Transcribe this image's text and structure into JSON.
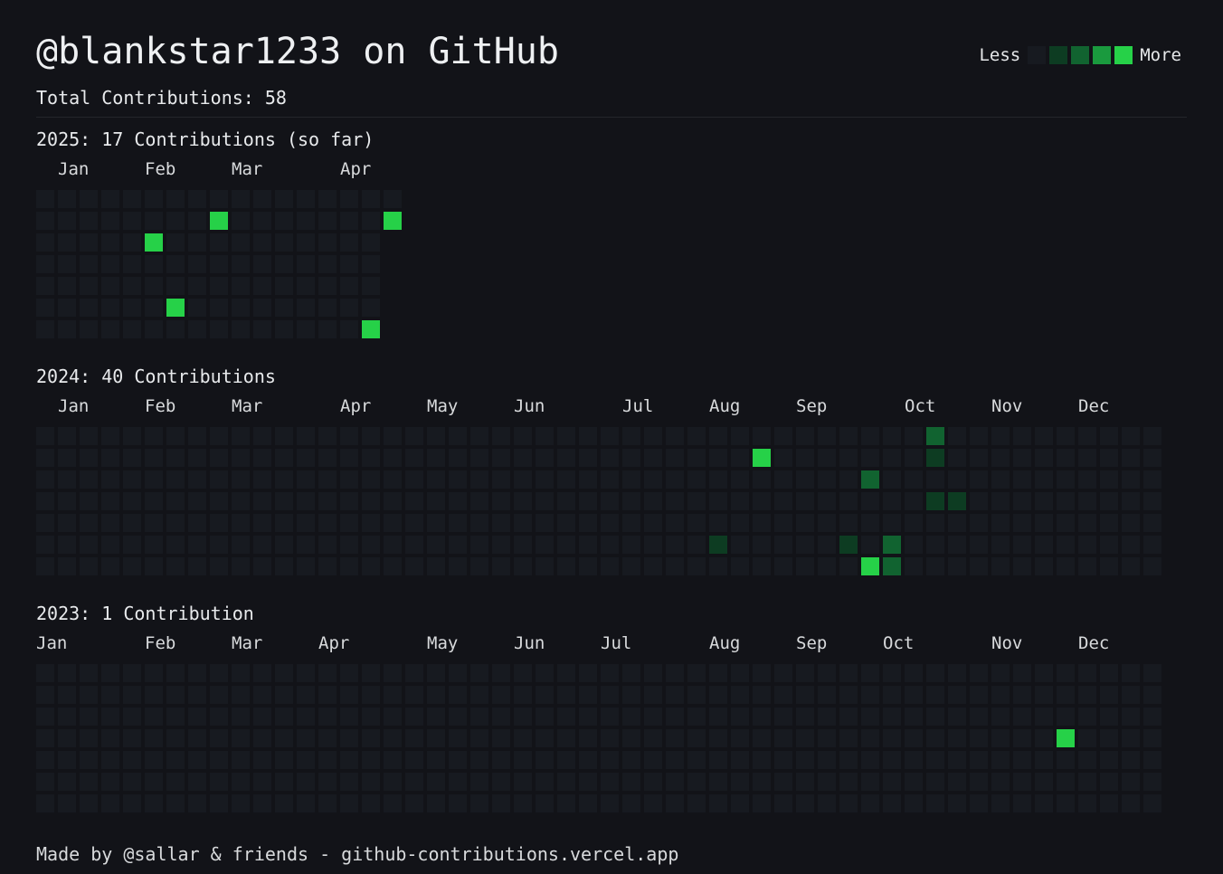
{
  "header": {
    "title": "@blankstar1233 on GitHub",
    "total": "Total Contributions: 58"
  },
  "legend": {
    "less": "Less",
    "more": "More",
    "levels": [
      "#171a20",
      "#0d3c22",
      "#116330",
      "#1a9a3e",
      "#26d148"
    ]
  },
  "years": [
    {
      "title": "2025: 17 Contributions (so far)",
      "weeks": 17,
      "last_week_days": 2,
      "months": [
        {
          "label": "Jan",
          "week": 1
        },
        {
          "label": "Feb",
          "week": 5
        },
        {
          "label": "Mar",
          "week": 9
        },
        {
          "label": "Apr",
          "week": 14
        }
      ],
      "active_days": [
        {
          "week": 8,
          "day": 1,
          "level": 4
        },
        {
          "week": 16,
          "day": 1,
          "level": 4
        },
        {
          "week": 5,
          "day": 2,
          "level": 4
        },
        {
          "week": 6,
          "day": 5,
          "level": 4
        },
        {
          "week": 15,
          "day": 6,
          "level": 4
        }
      ]
    },
    {
      "title": "2024: 40 Contributions",
      "weeks": 52,
      "last_week_days": 7,
      "months": [
        {
          "label": "Jan",
          "week": 1
        },
        {
          "label": "Feb",
          "week": 5
        },
        {
          "label": "Mar",
          "week": 9
        },
        {
          "label": "Apr",
          "week": 14
        },
        {
          "label": "May",
          "week": 18
        },
        {
          "label": "Jun",
          "week": 22
        },
        {
          "label": "Jul",
          "week": 27
        },
        {
          "label": "Aug",
          "week": 31
        },
        {
          "label": "Sep",
          "week": 35
        },
        {
          "label": "Oct",
          "week": 40
        },
        {
          "label": "Nov",
          "week": 44
        },
        {
          "label": "Dec",
          "week": 48
        }
      ],
      "active_days": [
        {
          "week": 41,
          "day": 0,
          "level": 2
        },
        {
          "week": 33,
          "day": 1,
          "level": 4
        },
        {
          "week": 41,
          "day": 1,
          "level": 1
        },
        {
          "week": 38,
          "day": 2,
          "level": 2
        },
        {
          "week": 41,
          "day": 3,
          "level": 1
        },
        {
          "week": 42,
          "day": 3,
          "level": 1
        },
        {
          "week": 31,
          "day": 5,
          "level": 1
        },
        {
          "week": 37,
          "day": 5,
          "level": 1
        },
        {
          "week": 39,
          "day": 5,
          "level": 2
        },
        {
          "week": 38,
          "day": 6,
          "level": 4
        },
        {
          "week": 39,
          "day": 6,
          "level": 2
        }
      ]
    },
    {
      "title": "2023: 1 Contribution",
      "weeks": 52,
      "last_week_days": 7,
      "months": [
        {
          "label": "Jan",
          "week": 0
        },
        {
          "label": "Feb",
          "week": 5
        },
        {
          "label": "Mar",
          "week": 9
        },
        {
          "label": "Apr",
          "week": 13
        },
        {
          "label": "May",
          "week": 18
        },
        {
          "label": "Jun",
          "week": 22
        },
        {
          "label": "Jul",
          "week": 26
        },
        {
          "label": "Aug",
          "week": 31
        },
        {
          "label": "Sep",
          "week": 35
        },
        {
          "label": "Oct",
          "week": 39
        },
        {
          "label": "Nov",
          "week": 44
        },
        {
          "label": "Dec",
          "week": 48
        }
      ],
      "active_days": [
        {
          "week": 47,
          "day": 3,
          "level": 4
        }
      ]
    }
  ],
  "footer": "Made by @sallar & friends - github-contributions.vercel.app"
}
